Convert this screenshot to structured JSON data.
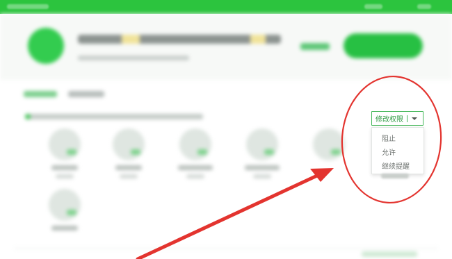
{
  "permission_dropdown": {
    "label": "修改权限",
    "options": [
      "阻止",
      "允许",
      "继续提醒"
    ]
  },
  "colors": {
    "brand_green": "#2cc43e",
    "annotation_red": "#e3342f"
  },
  "icons": {
    "dropdown": "chevron-down-icon"
  }
}
